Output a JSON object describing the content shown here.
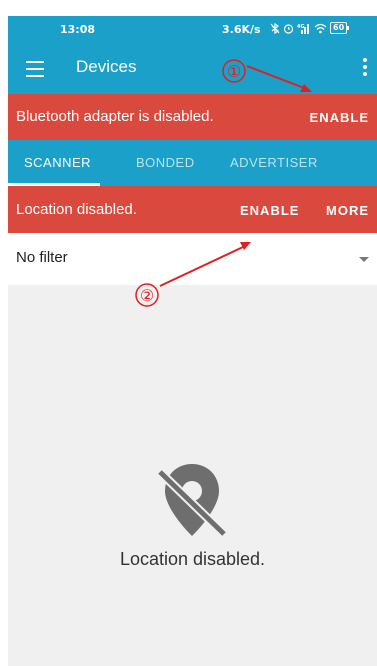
{
  "status_bar": {
    "time": "13:08",
    "network_speed": "3.6K/s",
    "battery": "60",
    "icons": [
      "bluetooth-off-icon",
      "alarm-icon",
      "signal-icon",
      "wifi-icon",
      "battery-icon"
    ]
  },
  "app_bar": {
    "title": "Devices",
    "menu_icon": "hamburger-icon",
    "overflow_icon": "more-vert-icon",
    "color": "#1ba0c9"
  },
  "bluetooth_banner": {
    "message": "Bluetooth adapter is disabled.",
    "action": "ENABLE",
    "color": "#d9493e"
  },
  "tabs": [
    {
      "label": "SCANNER",
      "active": true
    },
    {
      "label": "BONDED",
      "active": false
    },
    {
      "label": "ADVERTISER",
      "active": false
    }
  ],
  "location_banner": {
    "message": "Location disabled.",
    "enable_action": "ENABLE",
    "more_action": "MORE"
  },
  "filter": {
    "value": "No filter"
  },
  "empty_state": {
    "icon": "location-off-icon",
    "message": "Location disabled."
  },
  "annotations": {
    "marker_1": "①",
    "marker_2": "②",
    "color": "#e02020"
  }
}
